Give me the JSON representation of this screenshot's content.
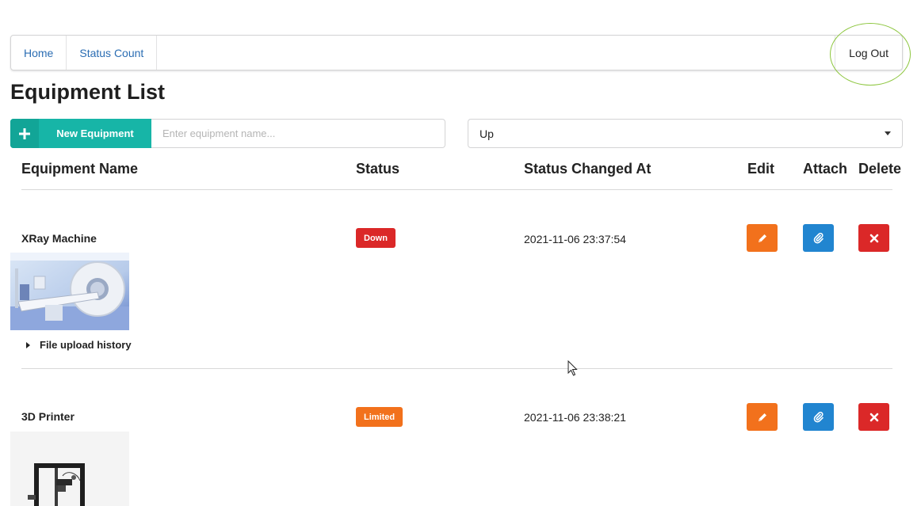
{
  "nav": {
    "items": [
      {
        "label": "Home"
      },
      {
        "label": "Status Count"
      }
    ],
    "logout_label": "Log Out"
  },
  "page_title": "Equipment List",
  "toolbar": {
    "new_button_label": "New Equipment",
    "search_placeholder": "Enter equipment name...",
    "search_value": "",
    "status_filter_value": "Up"
  },
  "table": {
    "columns": [
      "Equipment Name",
      "Status",
      "Status Changed At",
      "Edit",
      "Attach",
      "Delete"
    ],
    "rows": [
      {
        "name": "XRay Machine",
        "status": "Down",
        "status_color": "#db2828",
        "changed_at": "2021-11-06 23:37:54",
        "image": "ct-scanner-photo",
        "history_label": "File upload history"
      },
      {
        "name": "3D Printer",
        "status": "Limited",
        "status_color": "#f2711c",
        "changed_at": "2021-11-06 23:38:21",
        "image": "3d-printer-photo"
      }
    ]
  },
  "colors": {
    "primary_teal": "#17b5a7",
    "edit_orange": "#f2711c",
    "attach_blue": "#2185d0",
    "delete_red": "#db2828",
    "link_blue": "#2b6db3",
    "highlight_green": "#8dc63f"
  },
  "icons": {
    "edit": "pencil-icon",
    "attach": "paperclip-icon",
    "delete": "x-icon",
    "new": "plus-icon",
    "select": "caret-down-icon"
  }
}
